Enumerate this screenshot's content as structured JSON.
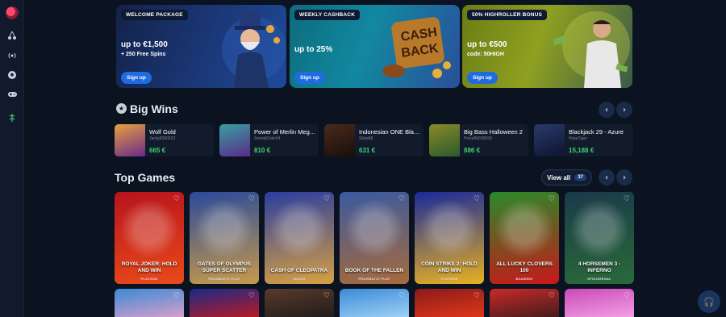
{
  "sidebar": {
    "icons": [
      "cherries-icon",
      "live-broadcast-icon",
      "football-icon",
      "gamepad-icon",
      "bonus-icon"
    ]
  },
  "promos": [
    {
      "tag": "WELCOME PACKAGE",
      "title": "up to €1,500",
      "sub": "+ 250 Free Spins",
      "button": "Sign up"
    },
    {
      "tag": "WEEKLY CASHBACK",
      "title": "up to 25%",
      "sub": "",
      "button": "Sign up"
    },
    {
      "tag": "50% HIGHROLLER BONUS",
      "title": "up to €500",
      "sub": "code: 50HIGH",
      "button": "Sign up"
    }
  ],
  "big_wins": {
    "title": "Big Wins",
    "items": [
      {
        "game": "Wolf Gold",
        "user": "Jacky8380523",
        "amount": "665 €"
      },
      {
        "game": "Power of Merlin Meg…",
        "user": "SenelyDoitch9",
        "amount": "810 €"
      },
      {
        "game": "Indonesian ONE Bla…",
        "user": "Sbbp88",
        "amount": "631 €"
      },
      {
        "game": "Big Bass Halloween 2",
        "user": "Pinxe86605699",
        "amount": "886 €"
      },
      {
        "game": "Blackjack 29 - Azure",
        "user": "HoseTiger",
        "amount": "15,188 €"
      }
    ]
  },
  "top_games": {
    "title": "Top Games",
    "view_all": "View all",
    "count": "37",
    "items": [
      {
        "title": "ROYAL JOKER: HOLD AND WIN",
        "provider": "PLAYSON",
        "colors": [
          "#b8141c",
          "#e84a1a"
        ]
      },
      {
        "title": "GATES OF OLYMPUS SUPER SCATTER",
        "provider": "PRAGMATIC PLAY",
        "colors": [
          "#2a4a9a",
          "#c89a4a"
        ]
      },
      {
        "title": "CASH OF CLEOPATRA",
        "provider": "3OAKS",
        "colors": [
          "#2a3ea0",
          "#d8a040"
        ]
      },
      {
        "title": "BOOK OF THE FALLEN",
        "provider": "PRAGMATIC PLAY",
        "colors": [
          "#3a5aa0",
          "#a86a3a"
        ]
      },
      {
        "title": "COIN STRIKE 2: HOLD AND WIN",
        "provider": "PLAYSON",
        "colors": [
          "#1a2a9a",
          "#e8b020"
        ]
      },
      {
        "title": "ALL LUCKY CLOVERS 100",
        "provider": "BGAMING",
        "colors": [
          "#2a8a2a",
          "#c81818"
        ]
      },
      {
        "title": "4 HORSEMEN 3 - INFERNO",
        "provider": "SPINOMENAL",
        "colors": [
          "#1a3a4a",
          "#2a6a3a"
        ]
      }
    ],
    "row2_colors": [
      [
        "#3a8ad8",
        "#e8a0c8"
      ],
      [
        "#1a2a8a",
        "#c81818"
      ],
      [
        "#5a3a2a",
        "#1a1a1a"
      ],
      [
        "#3a8ad8",
        "#a8d8f8"
      ],
      [
        "#8a1a1a",
        "#e83a1a"
      ],
      [
        "#c82a2a",
        "#3a1a1a"
      ],
      [
        "#c84ab8",
        "#f8a8e8"
      ]
    ]
  },
  "colors": {
    "accent": "#1f6be0",
    "win_green": "#3cd46b",
    "background": "#0b1220"
  }
}
